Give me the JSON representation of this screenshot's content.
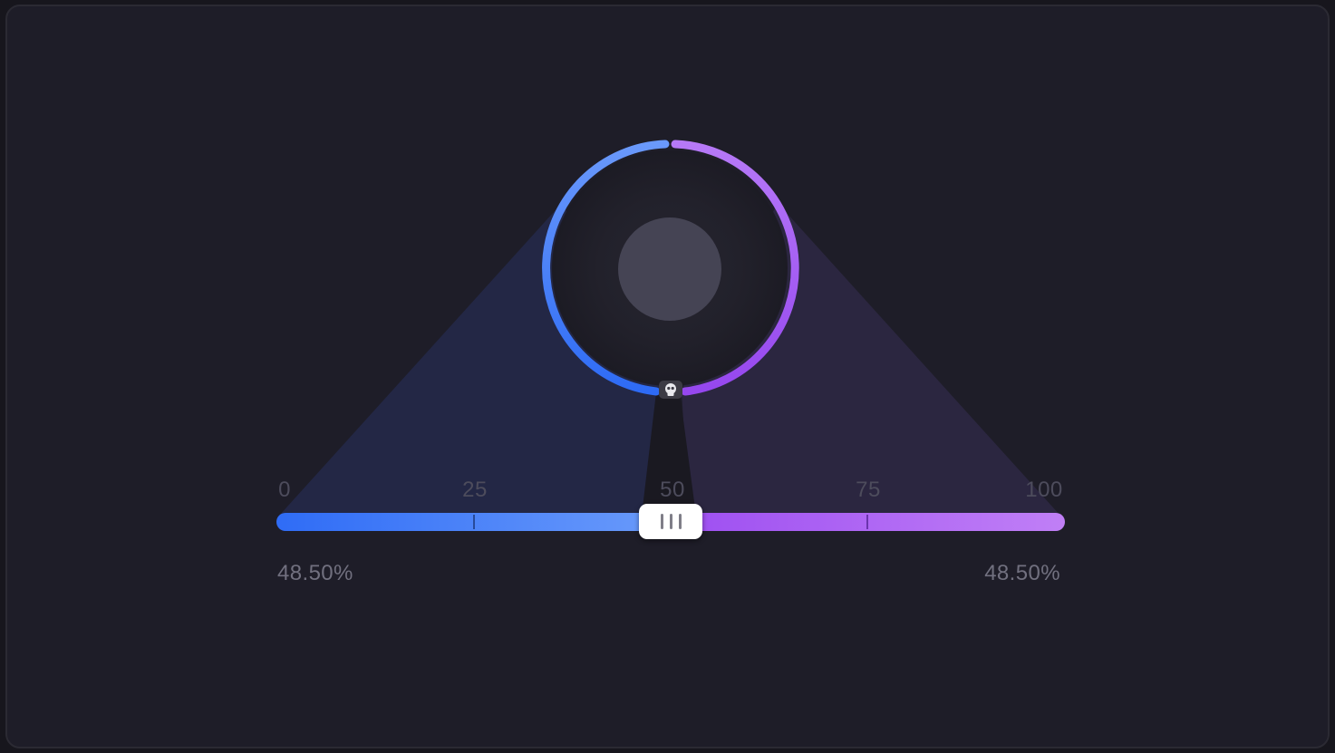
{
  "slider": {
    "min": 0,
    "max": 100,
    "value": 50,
    "ticks": [
      "0",
      "25",
      "50",
      "75",
      "100"
    ],
    "left_percent": "48.50%",
    "right_percent": "48.50%",
    "colors": {
      "left_start": "#2f6cf6",
      "left_end": "#6a9bfb",
      "right_start": "#9d4ef1",
      "right_end": "#c07ff6"
    }
  },
  "ring": {
    "left_color": "#4f86fb",
    "right_color": "#a85ef3",
    "indicator_icon": "skull-icon"
  }
}
